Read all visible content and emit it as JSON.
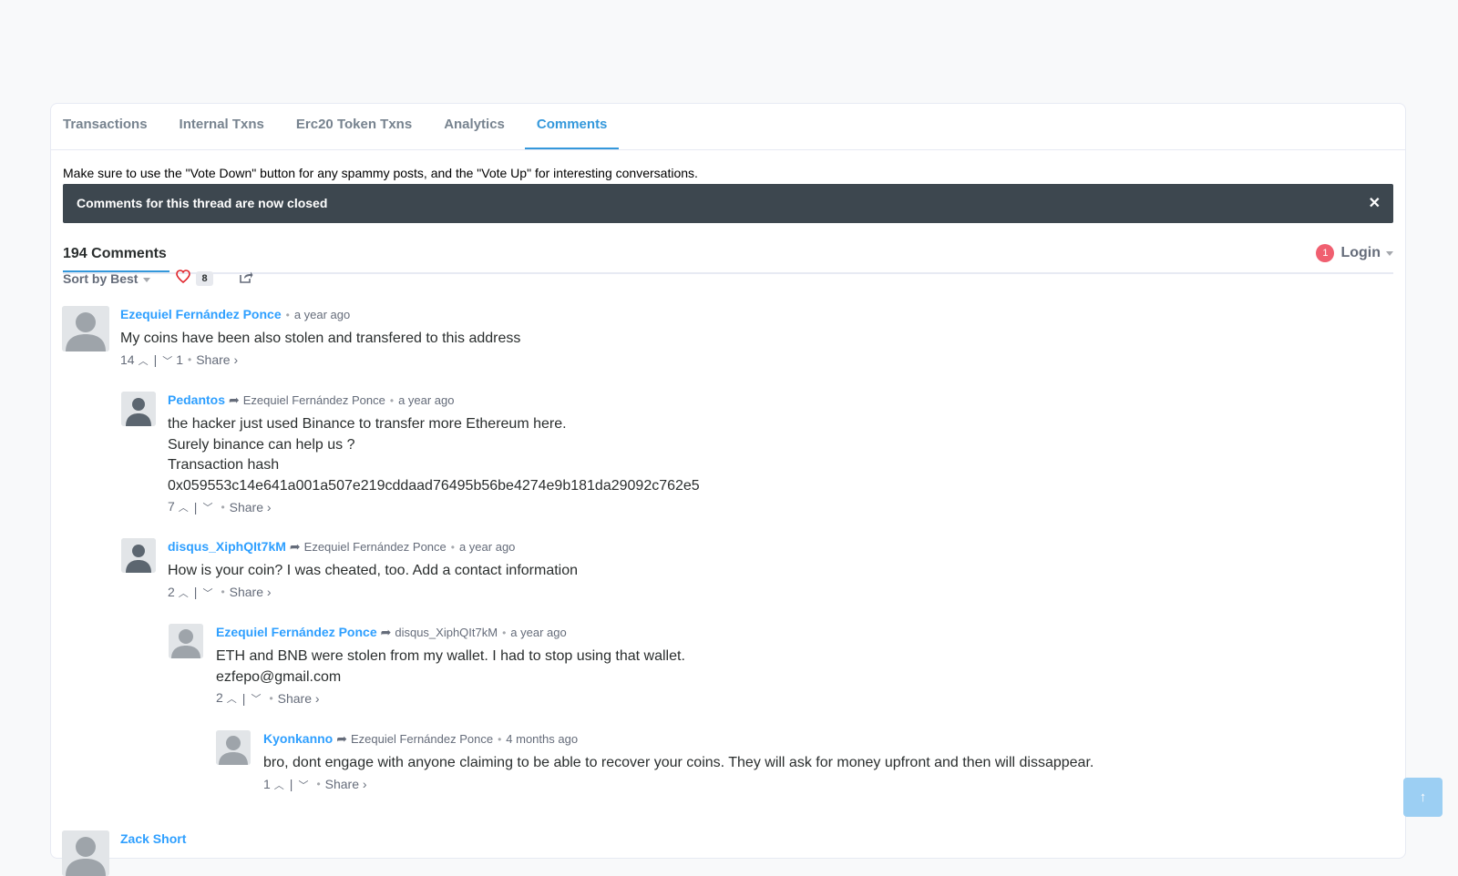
{
  "tabs": [
    "Transactions",
    "Internal Txns",
    "Erc20 Token Txns",
    "Analytics",
    "Comments"
  ],
  "notice": "Make sure to use the \"Vote Down\" button for any spammy posts, and the \"Vote Up\" for interesting conversations.",
  "closed_message": "Comments for this thread are now closed",
  "close_symbol": "✕",
  "comments_count": "194 Comments",
  "login": {
    "badge": "1",
    "label": "Login"
  },
  "toolbar": {
    "sort_label": "Sort by Best",
    "recommend_count": "8"
  },
  "comments": [
    {
      "author": "Ezequiel Fernández Ponce",
      "parent": "",
      "time": "a year ago",
      "text": [
        "My coins have been also stolen and transfered to this address"
      ],
      "upvotes": "14",
      "downvotes": "1",
      "share": "Share ›"
    },
    {
      "author": "Pedantos",
      "parent": "Ezequiel Fernández Ponce",
      "time": "a year ago",
      "text": [
        "the hacker just used Binance to transfer more Ethereum here.",
        "Surely binance can help us ?",
        "Transaction hash",
        "0x059553c14e641a001a507e219cddaad76495b56be4274e9b181da29092c762e5"
      ],
      "upvotes": "7",
      "downvotes": "",
      "share": "Share ›"
    },
    {
      "author": "disqus_XiphQIt7kM",
      "parent": "Ezequiel Fernández Ponce",
      "time": "a year ago",
      "text": [
        "How is your coin? I was cheated, too. Add a contact information"
      ],
      "upvotes": "2",
      "downvotes": "",
      "share": "Share ›"
    },
    {
      "author": "Ezequiel Fernández Ponce",
      "parent": "disqus_XiphQIt7kM",
      "time": "a year ago",
      "text": [
        "ETH and BNB were stolen from my wallet. I had to stop using that wallet.",
        "ezfepo@gmail.com"
      ],
      "upvotes": "2",
      "downvotes": "",
      "share": "Share ›"
    },
    {
      "author": "Kyonkanno",
      "parent": "Ezequiel Fernández Ponce",
      "time": "4 months ago",
      "text": [
        "bro, dont engage with anyone claiming to be able to recover your coins. They will ask for money upfront and then will dissappear."
      ],
      "upvotes": "1",
      "downvotes": "",
      "share": "Share ›"
    },
    {
      "author": "Zack Short",
      "parent": "",
      "time": "",
      "text": [],
      "upvotes": "",
      "downvotes": "",
      "share": ""
    }
  ],
  "scroll_top_symbol": "↑",
  "colors": {
    "accent": "#3498db",
    "author": "#2e9fff",
    "closed_bar": "#3d474f",
    "badge": "#f05f70"
  }
}
